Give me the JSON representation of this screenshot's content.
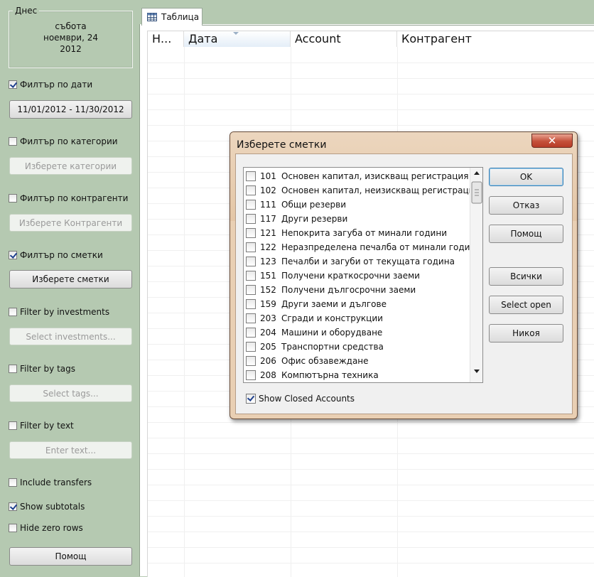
{
  "left_panel": {
    "today_legend": "Днес",
    "today_lines": [
      "събота",
      "ноември, 24",
      "2012"
    ],
    "date_filter_label": "Филтър по дати",
    "date_range_button": "11/01/2012 - 11/30/2012",
    "category_filter_label": "Филтър по категории",
    "category_button": "Изберете категории",
    "payee_filter_label": "Филтър по контрагенти",
    "payee_button": "Изберете Контрагенти",
    "account_filter_label": "Филтър по сметки",
    "account_button": "Изберете сметки",
    "investment_filter_label": "Filter by investments",
    "investment_button": "Select investments...",
    "tag_filter_label": "Filter by tags",
    "tag_button": "Select tags...",
    "text_filter_label": "Filter by text",
    "text_input_placeholder": "Enter text...",
    "include_transfers_label": "Include transfers",
    "show_subtotals_label": "Show subtotals",
    "hide_zero_rows_label": "Hide zero rows",
    "help_button": "Помощ"
  },
  "tab": {
    "label": "Таблица"
  },
  "table": {
    "columns": [
      "Н...",
      "Дата",
      "Account",
      "Контрагент"
    ]
  },
  "dialog": {
    "title": "Изберете сметки",
    "close_label": "✕",
    "accounts": [
      {
        "code": "101",
        "name": "Основен капитал, изискващ регистрация"
      },
      {
        "code": "102",
        "name": "Основен капитал, неизискващ регистрация"
      },
      {
        "code": "111",
        "name": "Общи резерви"
      },
      {
        "code": "117",
        "name": "Други резерви"
      },
      {
        "code": "121",
        "name": "Непокрита загуба от минали години"
      },
      {
        "code": "122",
        "name": "Неразпределена печалба от минали години"
      },
      {
        "code": "123",
        "name": "Печалби и загуби от текущата година"
      },
      {
        "code": "151",
        "name": "Получени краткосрочни заеми"
      },
      {
        "code": "152",
        "name": "Получени дългосрочни заеми"
      },
      {
        "code": "159",
        "name": "Други заеми и дългове"
      },
      {
        "code": "203",
        "name": "Сгради и конструкции"
      },
      {
        "code": "204",
        "name": "Машини и оборудване"
      },
      {
        "code": "205",
        "name": "Транспортни средства"
      },
      {
        "code": "206",
        "name": "Офис обзавеждане"
      },
      {
        "code": "208",
        "name": "Компютърна техника"
      }
    ],
    "show_closed_label": "Show Closed Accounts",
    "buttons": {
      "ok": "OK",
      "cancel": "Отказ",
      "help": "Помощ",
      "all": "Всички",
      "select_open": "Select open",
      "none": "Никоя"
    }
  }
}
